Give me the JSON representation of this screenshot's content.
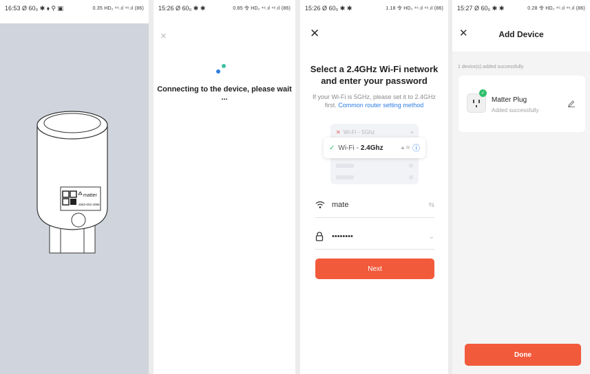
{
  "screens": {
    "s1": {
      "status_time": "16:53",
      "status_left_extra": "Ø 60₀ ✱ ⬧ ⚲ ▣",
      "status_right": "0.35 HD₂ ⁴⁶.ıl ⁴⁶.ıl (86)",
      "device_label_brand": "matter",
      "device_label_code": "2563-002-4096"
    },
    "s2": {
      "status_time": "15:26",
      "status_left_extra": "Ø 60₀ ✱ ✱",
      "status_right": "0.85 令 HD₂ ⁴⁶.ıl ⁴⁶.ıl (86)",
      "close_glyph": "×",
      "connecting_text": "Connecting to the device, please wait ..."
    },
    "s3": {
      "status_time": "15:26",
      "status_left_extra": "Ø 60₀ ✱ ✱",
      "status_right": "1.18 令 HD₂ ⁴⁶.ıl ⁴⁶.ıl (86)",
      "close_glyph": "✕",
      "title_line1": "Select a 2.4GHz Wi-Fi network",
      "title_line2": "and enter your password",
      "subtitle": "If your Wi-Fi is 5GHz, please set it to 2.4GHz first.",
      "link_text": "Common router setting method",
      "net_5g_prefix": "Wi-Fi -",
      "net_5g_band": "5Ghz",
      "net_24_prefix": "Wi-Fi -",
      "net_24_band": "2.4Ghz",
      "wifi_name": "mate",
      "password_masked": "••••••••",
      "next_label": "Next"
    },
    "s4": {
      "status_time": "15:27",
      "status_left_extra": "Ø 60₀ ✱ ✱",
      "status_right": "0.28 令 HD₂ ⁴⁶.ıl ⁴⁶.ıl (86)",
      "close_glyph": "✕",
      "title": "Add Device",
      "added_count_text": "1 device(s) added successfully",
      "device_name": "Matter Plug",
      "device_status": "Added successfully",
      "done_label": "Done"
    }
  },
  "colors": {
    "accent": "#f25a3c",
    "success": "#2fbf6b",
    "link": "#2f7de1",
    "stage_bg": "#d0d5dd"
  }
}
